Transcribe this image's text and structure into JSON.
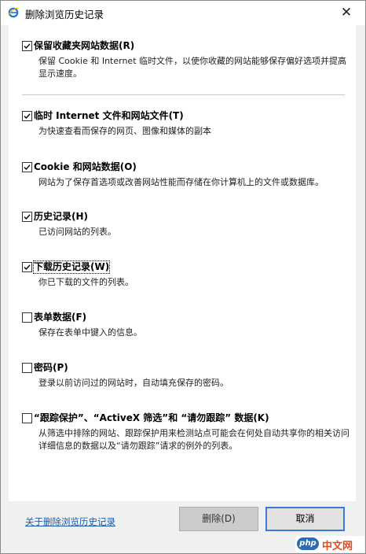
{
  "window": {
    "title": "删除浏览历史记录",
    "close_glyph": "✕"
  },
  "options": [
    {
      "label": "保留收藏夹网站数据(R)",
      "checked": true,
      "description": "保留 Cookie 和 Internet 临时文件，以使你收藏的网站能够保存偏好选项并提高显示速度。"
    },
    {
      "label": "临时 Internet 文件和网站文件(T)",
      "checked": true,
      "description": "为快速查看而保存的网页、图像和媒体的副本"
    },
    {
      "label": "Cookie 和网站数据(O)",
      "checked": true,
      "description": "网站为了保存首选项或改善网站性能而存储在你计算机上的文件或数据库。"
    },
    {
      "label": "历史记录(H)",
      "checked": true,
      "description": "已访问网站的列表。"
    },
    {
      "label": "下载历史记录(W)",
      "checked": true,
      "description": "你已下载的文件的列表。"
    },
    {
      "label": "表单数据(F)",
      "checked": false,
      "description": "保存在表单中键入的信息。"
    },
    {
      "label": "密码(P)",
      "checked": false,
      "description": "登录以前访问过的网站时，自动填充保存的密码。"
    },
    {
      "label": "“跟踪保护”、“ActiveX 筛选”和 “请勿跟踪” 数据(K)",
      "checked": false,
      "description": "从筛选中排除的网站、跟踪保护用来检测站点可能会在何处自动共享你的相关访问详细信息的数据以及“请勿跟踪”请求的例外的列表。"
    }
  ],
  "footer": {
    "about_link": "关于删除浏览历史记录",
    "delete_label": "删除(D)",
    "cancel_label": "取消"
  },
  "watermark": {
    "badge": "php",
    "text": "中文网"
  },
  "colors": {
    "link": "#1a5aa6",
    "focus_border": "#3d7ad7",
    "ie_icon": "#1e78d2"
  }
}
